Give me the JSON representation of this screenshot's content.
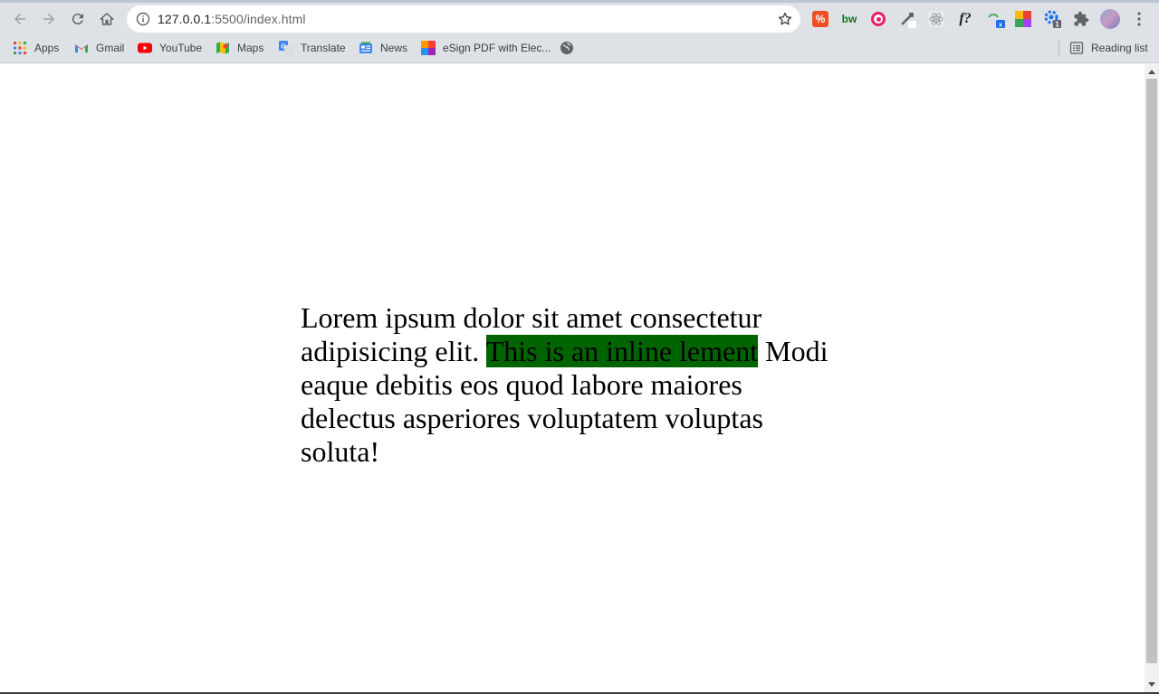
{
  "browser": {
    "url_host": "127.0.0.1",
    "url_path": ":5500/index.html",
    "reading_list_label": "Reading list"
  },
  "bookmarks": [
    {
      "label": "Apps",
      "icon": "apps-grid-icon"
    },
    {
      "label": "Gmail",
      "icon": "gmail-icon"
    },
    {
      "label": "YouTube",
      "icon": "youtube-icon"
    },
    {
      "label": "Maps",
      "icon": "maps-icon"
    },
    {
      "label": "Translate",
      "icon": "translate-icon"
    },
    {
      "label": "News",
      "icon": "news-icon"
    },
    {
      "label": "eSign PDF with Elec...",
      "icon": "esign-icon"
    }
  ],
  "extensions": [
    {
      "name": "extension-orange-icon",
      "text": "%"
    },
    {
      "name": "extension-bw-icon",
      "text": "bw"
    },
    {
      "name": "extension-pink-eye-icon",
      "text": ""
    },
    {
      "name": "extension-eyedropper-icon",
      "text": ""
    },
    {
      "name": "extension-react-icon",
      "text": ""
    },
    {
      "name": "extension-font-icon",
      "text": "f?"
    },
    {
      "name": "extension-translate-icon",
      "text": ""
    },
    {
      "name": "extension-colorful-icon",
      "text": ""
    },
    {
      "name": "extension-gear-icon",
      "text": ""
    },
    {
      "name": "extensions-puzzle-icon",
      "text": ""
    }
  ],
  "page": {
    "text_before": "Lorem ipsum dolor sit amet consectetur adipisicing elit. ",
    "inline_text": "This is an inline lement",
    "text_after": " Modi eaque debitis eos quod labore maiores delectus asperiores voluptatem voluptas soluta!",
    "inline_bg": "#006400"
  }
}
